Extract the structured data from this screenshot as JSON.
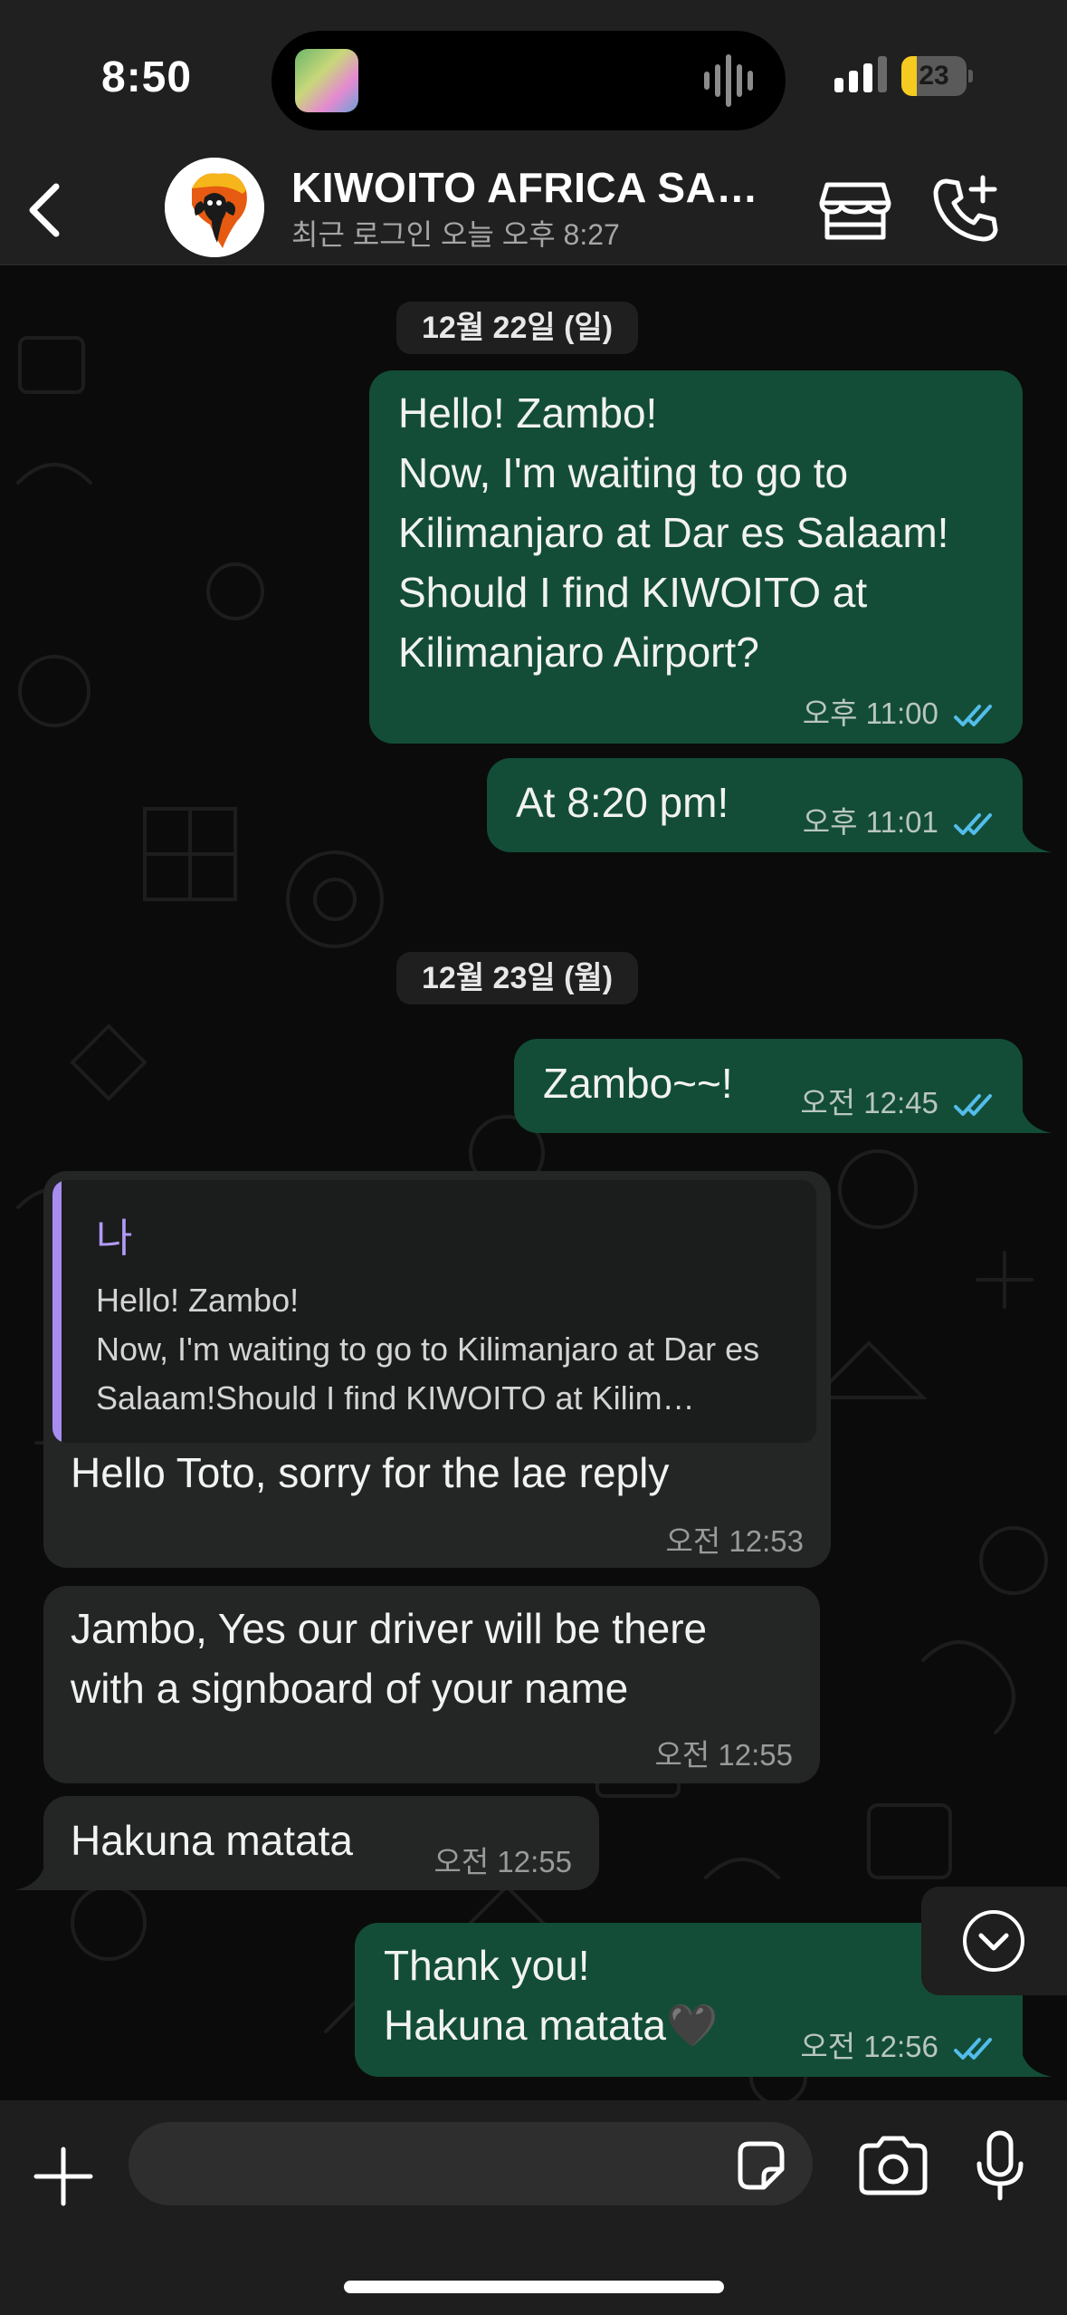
{
  "status_bar": {
    "time": "8:50",
    "battery": "23",
    "battery_level": 0.23
  },
  "header": {
    "back_icon": "chevron-left-icon",
    "contact_name": "KIWOITO AFRICA SAFARI",
    "last_seen": "최근 로그인 오늘 오후 8:27",
    "actions": [
      "storefront-icon",
      "add-call-icon"
    ]
  },
  "chat": {
    "dates": [
      "12월 22일 (일)",
      "12월 23일 (월)"
    ],
    "messages": [
      {
        "direction": "outgoing",
        "text": "Hello! Zambo!\nNow, I'm waiting to go to\nKilimanjaro at Dar es Salaam!\nShould I find KIWOITO at\nKilimanjaro Airport?",
        "time": "오후 11:00",
        "status": "read"
      },
      {
        "direction": "outgoing",
        "text": "At 8:20 pm!",
        "time": "오후 11:01",
        "status": "read"
      },
      {
        "direction": "outgoing",
        "text": "Zambo~~!",
        "time": "오전 12:45",
        "status": "read"
      },
      {
        "direction": "incoming",
        "quoted": {
          "author": "나",
          "text": "Hello! Zambo!\nNow, I'm waiting to go to Kilimanjaro at Dar es Salaam!Should I find KIWOITO at Kilim…"
        },
        "text": "Hello Toto, sorry for the lae reply",
        "time": "오전 12:53"
      },
      {
        "direction": "incoming",
        "text": "Jambo, Yes our driver will be there\nwith a signboard of your name",
        "time": "오전 12:55"
      },
      {
        "direction": "incoming",
        "text": "Hakuna matata",
        "time": "오전 12:55"
      },
      {
        "direction": "outgoing",
        "text": "Thank you!\nHakuna matata🖤",
        "time": "오전 12:56",
        "status": "read"
      }
    ],
    "scroll_down_icon": "chevron-down-circle-icon"
  },
  "composer": {
    "placeholder": "",
    "icons": [
      "plus-icon",
      "sticker-icon",
      "camera-icon",
      "microphone-icon"
    ]
  },
  "colors": {
    "outgoing_bubble": "#134d37",
    "incoming_bubble": "#242626",
    "read_tick": "#53bdeb",
    "quote_accent": "#a88df0"
  }
}
